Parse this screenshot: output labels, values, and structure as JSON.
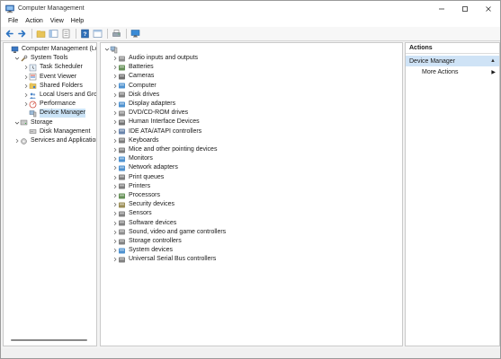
{
  "window": {
    "title": "Computer Management"
  },
  "menu": [
    "File",
    "Action",
    "View",
    "Help"
  ],
  "left_tree": [
    {
      "label": "Computer Management (Local",
      "icon": "computer-management-icon",
      "expander": "",
      "indent": 0,
      "selected": false
    },
    {
      "label": "System Tools",
      "icon": "tools-icon",
      "expander": "open",
      "indent": 1,
      "selected": false
    },
    {
      "label": "Task Scheduler",
      "icon": "clock-icon",
      "expander": "closed",
      "indent": 2,
      "selected": false
    },
    {
      "label": "Event Viewer",
      "icon": "event-viewer-icon",
      "expander": "closed",
      "indent": 2,
      "selected": false
    },
    {
      "label": "Shared Folders",
      "icon": "shared-folder-icon",
      "expander": "closed",
      "indent": 2,
      "selected": false
    },
    {
      "label": "Local Users and Groups",
      "icon": "users-icon",
      "expander": "closed",
      "indent": 2,
      "selected": false
    },
    {
      "label": "Performance",
      "icon": "performance-icon",
      "expander": "closed",
      "indent": 2,
      "selected": false
    },
    {
      "label": "Device Manager",
      "icon": "device-manager-icon",
      "expander": "",
      "indent": 2,
      "selected": true
    },
    {
      "label": "Storage",
      "icon": "storage-icon",
      "expander": "open",
      "indent": 1,
      "selected": false
    },
    {
      "label": "Disk Management",
      "icon": "disk-icon",
      "expander": "",
      "indent": 2,
      "selected": false
    },
    {
      "label": "Services and Applications",
      "icon": "services-icon",
      "expander": "closed",
      "indent": 1,
      "selected": false
    }
  ],
  "device_tree": {
    "root_icon": "computer-icon",
    "items": [
      {
        "label": "Audio inputs and outputs",
        "icon": "speaker-icon",
        "color": "#7a7a7a"
      },
      {
        "label": "Batteries",
        "icon": "battery-icon",
        "color": "#4a7d3a"
      },
      {
        "label": "Cameras",
        "icon": "camera-icon",
        "color": "#555555"
      },
      {
        "label": "Computer",
        "icon": "monitor-icon",
        "color": "#2f7fc8"
      },
      {
        "label": "Disk drives",
        "icon": "disk-drive-icon",
        "color": "#6b6b6b"
      },
      {
        "label": "Display adapters",
        "icon": "display-adapter-icon",
        "color": "#2f7fc8"
      },
      {
        "label": "DVD/CD-ROM drives",
        "icon": "dvd-icon",
        "color": "#777777"
      },
      {
        "label": "Human Interface Devices",
        "icon": "hid-icon",
        "color": "#5a5a5a"
      },
      {
        "label": "IDE ATA/ATAPI controllers",
        "icon": "ide-controller-icon",
        "color": "#4e6e9e"
      },
      {
        "label": "Keyboards",
        "icon": "keyboard-icon",
        "color": "#666666"
      },
      {
        "label": "Mice and other pointing devices",
        "icon": "mouse-icon",
        "color": "#666666"
      },
      {
        "label": "Monitors",
        "icon": "monitor-icon",
        "color": "#2f7fc8"
      },
      {
        "label": "Network adapters",
        "icon": "network-adapter-icon",
        "color": "#2f7fc8"
      },
      {
        "label": "Print queues",
        "icon": "print-queue-icon",
        "color": "#666666"
      },
      {
        "label": "Printers",
        "icon": "printer-icon",
        "color": "#666666"
      },
      {
        "label": "Processors",
        "icon": "processor-icon",
        "color": "#4a7d3a"
      },
      {
        "label": "Security devices",
        "icon": "security-device-icon",
        "color": "#8a7a3a"
      },
      {
        "label": "Sensors",
        "icon": "sensor-icon",
        "color": "#6b6b6b"
      },
      {
        "label": "Software devices",
        "icon": "software-device-icon",
        "color": "#6b6b6b"
      },
      {
        "label": "Sound, video and game controllers",
        "icon": "sound-icon",
        "color": "#7a7a7a"
      },
      {
        "label": "Storage controllers",
        "icon": "storage-controller-icon",
        "color": "#6b6b6b"
      },
      {
        "label": "System devices",
        "icon": "system-device-icon",
        "color": "#2f7fc8"
      },
      {
        "label": "Universal Serial Bus controllers",
        "icon": "usb-icon",
        "color": "#6b6b6b"
      }
    ]
  },
  "actions": {
    "header": "Actions",
    "section": "Device Manager",
    "items": [
      "More Actions"
    ]
  },
  "colors": {
    "selection": "#cce4f7",
    "actions_section": "#cfe3f6",
    "accent": "#2f7fc8"
  }
}
